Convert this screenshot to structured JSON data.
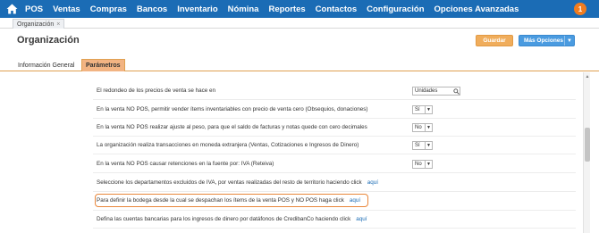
{
  "nav": {
    "items": [
      "POS",
      "Ventas",
      "Compras",
      "Bancos",
      "Inventario",
      "Nómina",
      "Reportes",
      "Contactos",
      "Configuración",
      "Opciones Avanzadas"
    ],
    "notification_count": "1"
  },
  "doc_tab": {
    "label": "Organización",
    "close": "×"
  },
  "header": {
    "title": "Organización",
    "save_label": "Guardar",
    "more_label": "Más Opciones"
  },
  "section_tabs": [
    "Información General",
    "Parámetros"
  ],
  "settings": [
    {
      "label": "El redondeo de los precios de venta se hace en",
      "value": "Unidades"
    },
    {
      "label": "En la venta NO POS, permitir vender ítems inventariables con precio de venta cero (Obsequios, donaciones)",
      "value": "Sí"
    },
    {
      "label": "En la venta NO POS realizar ajuste al peso, para que el saldo de facturas y notas quede con cero decimales",
      "value": "No"
    },
    {
      "label": "La organización realiza transacciones en moneda extranjera (Ventas, Cotizaciones e Ingresos de Dinero)",
      "value": "Sí"
    },
    {
      "label": "En la venta NO POS causar retenciones en la fuente por: IVA (Reteiva)",
      "value": "No"
    },
    {
      "label": "Seleccione los departamentos excluidos de IVA, por ventas realizadas del resto de territorio haciendo click",
      "link": "aquí"
    },
    {
      "label": "Para definir la bodega desde la cual se despachan los ítems de la venta POS y NO POS haga click",
      "link": "aquí"
    },
    {
      "label": "Defina las cuentas bancarias para los ingresos de dinero por datáfonos de CredibanCo haciendo click",
      "link": "aquí"
    }
  ],
  "colors": {
    "nav_bg": "#1b6cb5",
    "save_bg": "#f0ad5c",
    "more_bg": "#4a9be0",
    "active_tab": "#f2b483",
    "highlight": "#e9873b"
  }
}
